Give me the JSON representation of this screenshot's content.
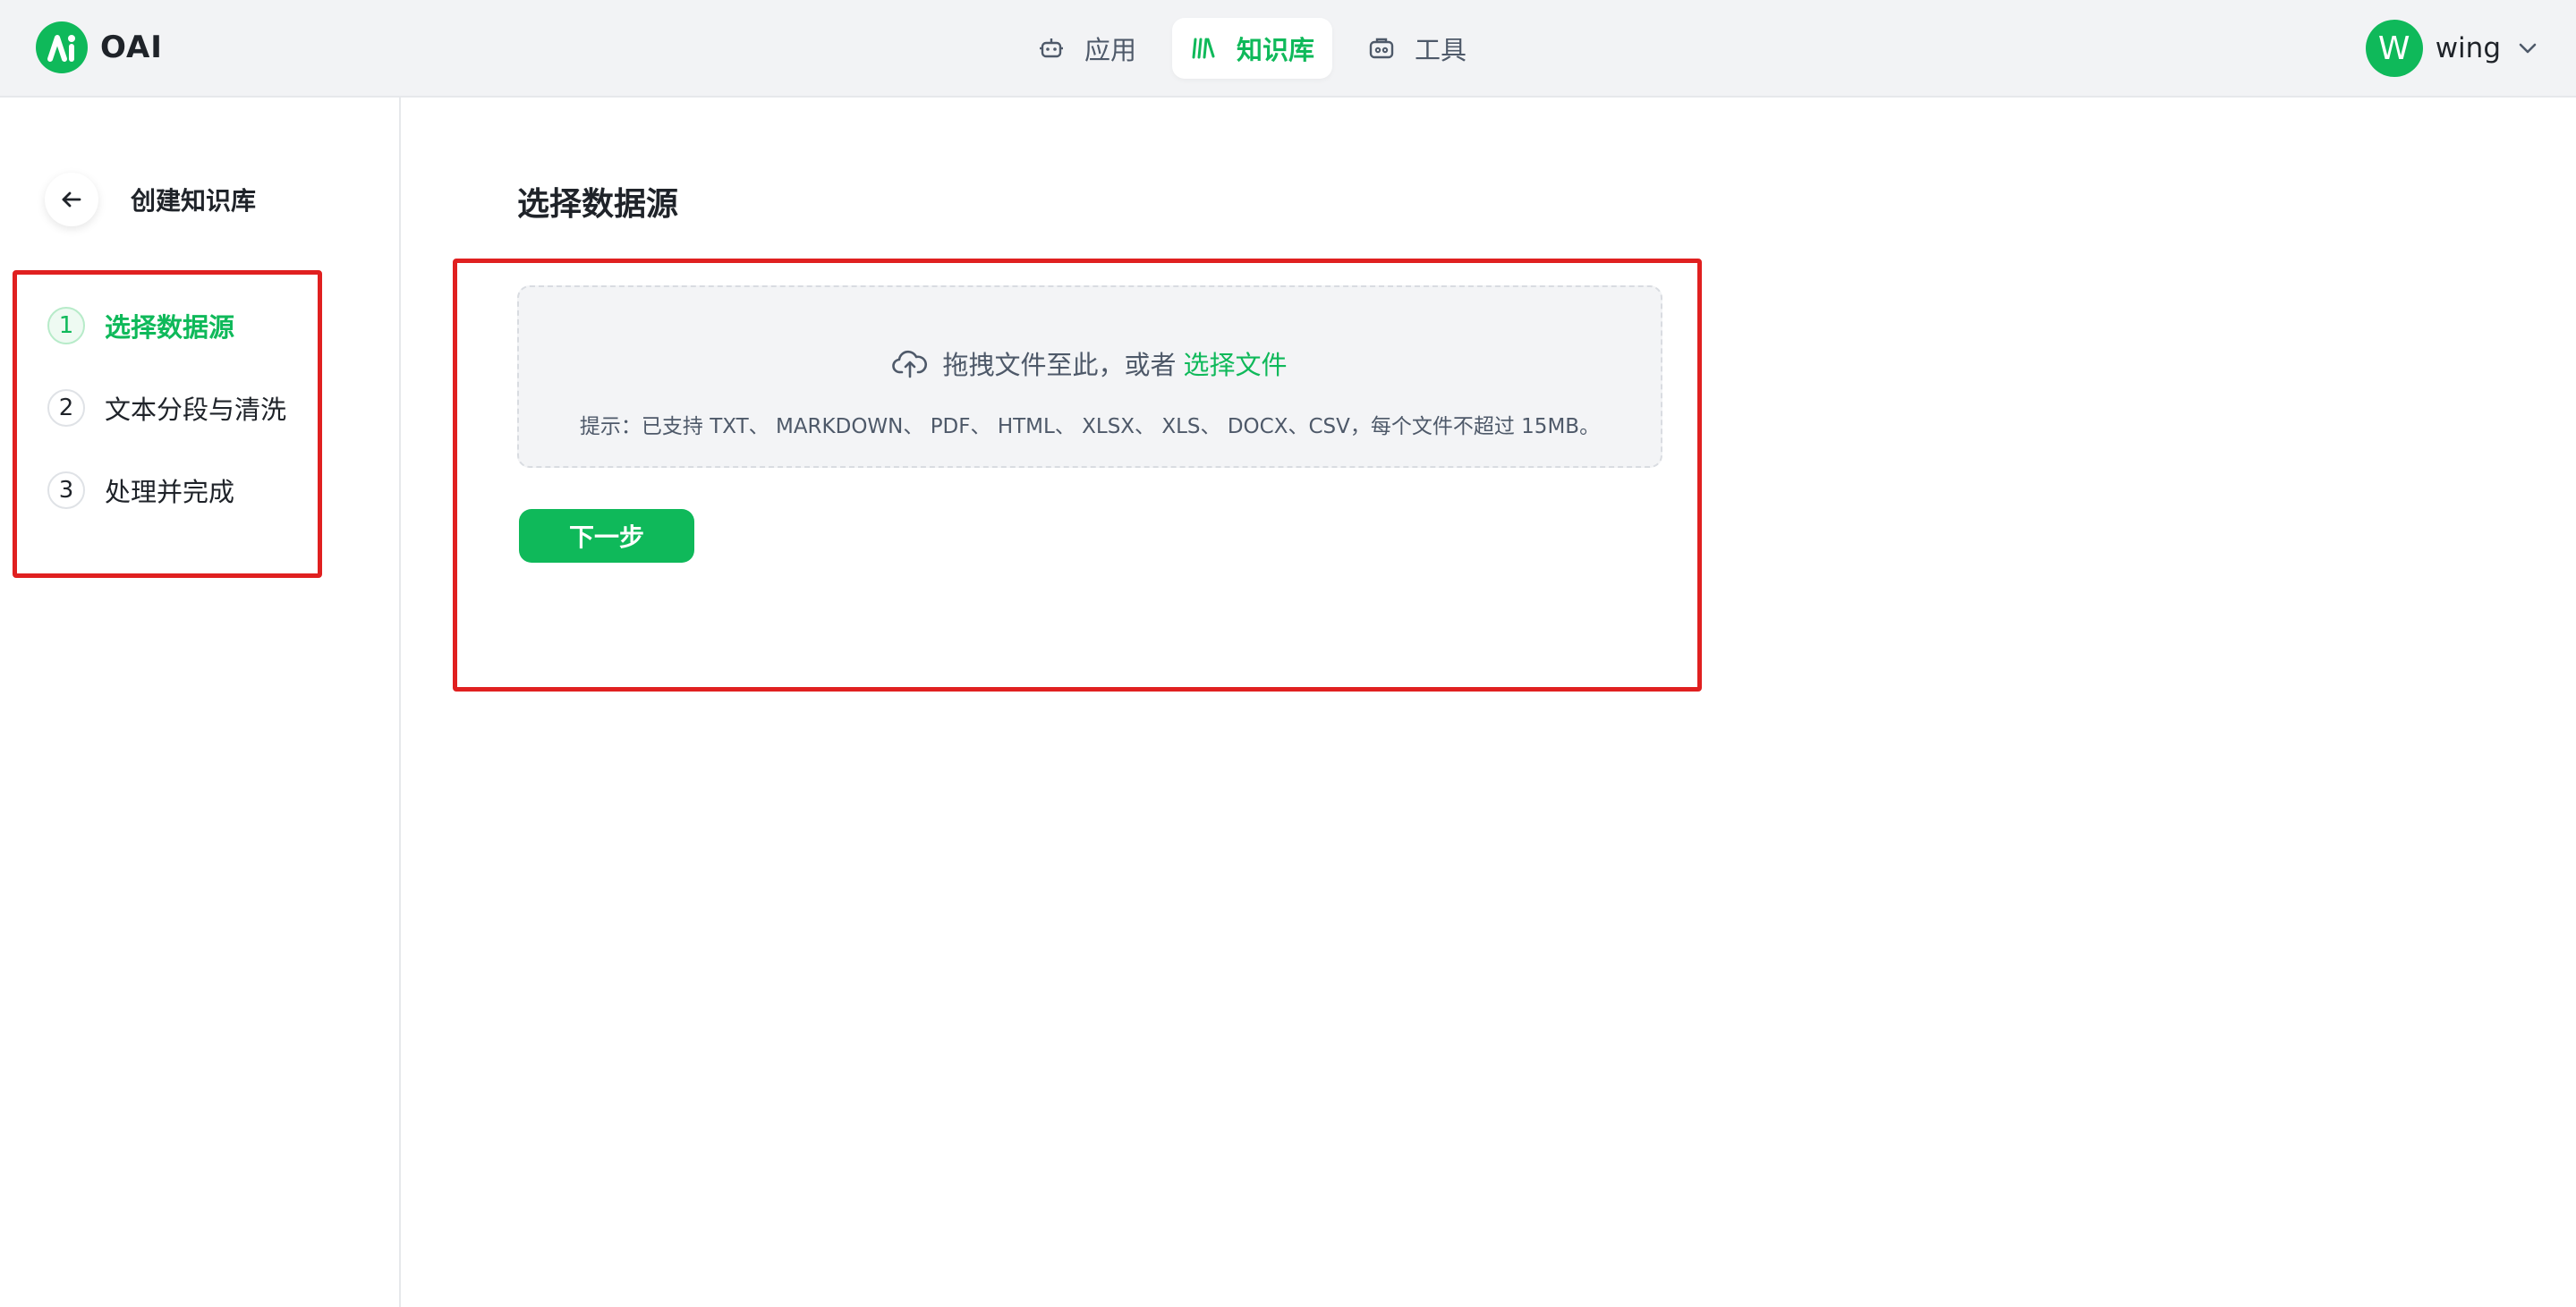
{
  "brand": {
    "name": "OAI",
    "logo_icon": "ai-logo-icon",
    "accent": "#0fb95a"
  },
  "nav": {
    "items": [
      {
        "label": "应用",
        "icon": "robot-icon",
        "active": false
      },
      {
        "label": "知识库",
        "icon": "library-icon",
        "active": true
      },
      {
        "label": "工具",
        "icon": "toolbox-icon",
        "active": false
      }
    ]
  },
  "user": {
    "avatar_letter": "W",
    "name": "wing"
  },
  "sidebar": {
    "title": "创建知识库",
    "steps": [
      {
        "num": "1",
        "label": "选择数据源",
        "active": true
      },
      {
        "num": "2",
        "label": "文本分段与清洗",
        "active": false
      },
      {
        "num": "3",
        "label": "处理并完成",
        "active": false
      }
    ]
  },
  "main": {
    "title": "选择数据源",
    "upload": {
      "drag_text": "拖拽文件至此，或者",
      "select_link": "选择文件",
      "hint": "提示：已支持 TXT、 MARKDOWN、 PDF、 HTML、 XLSX、 XLS、 DOCX、CSV，每个文件不超过 15MB。"
    },
    "next_button": "下一步"
  },
  "colors": {
    "highlight_box": "#e02020",
    "primary": "#0fb95a"
  }
}
